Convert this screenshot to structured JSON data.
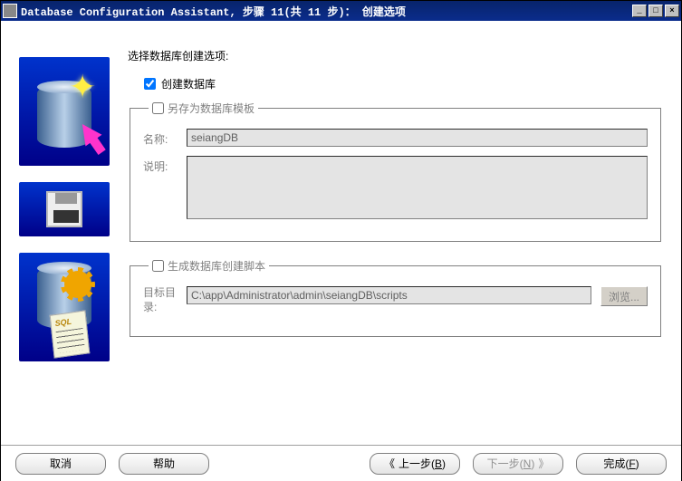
{
  "window": {
    "title": "Database Configuration Assistant, 步骤 11(共 11 步)： 创建选项"
  },
  "main": {
    "heading": "选择数据库创建选项:",
    "create_db_label": "创建数据库",
    "create_db_checked": true
  },
  "template_fs": {
    "legend": "另存为数据库模板",
    "checked": false,
    "name_label": "名称:",
    "name_value": "seiangDB",
    "desc_label": "说明:",
    "desc_value": ""
  },
  "script_fs": {
    "legend": "生成数据库创建脚本",
    "checked": false,
    "dir_label": "目标目录:",
    "dir_value": "C:\\app\\Administrator\\admin\\seiangDB\\scripts",
    "browse_label": "浏览..."
  },
  "footer": {
    "cancel": "取消",
    "help": "帮助",
    "back_prefix": "上一步(",
    "back_mnemonic": "B",
    "back_suffix": ")",
    "next_prefix": "下一步(",
    "next_mnemonic": "N",
    "next_suffix": ")",
    "finish_prefix": "完成(",
    "finish_mnemonic": "F",
    "finish_suffix": ")"
  }
}
